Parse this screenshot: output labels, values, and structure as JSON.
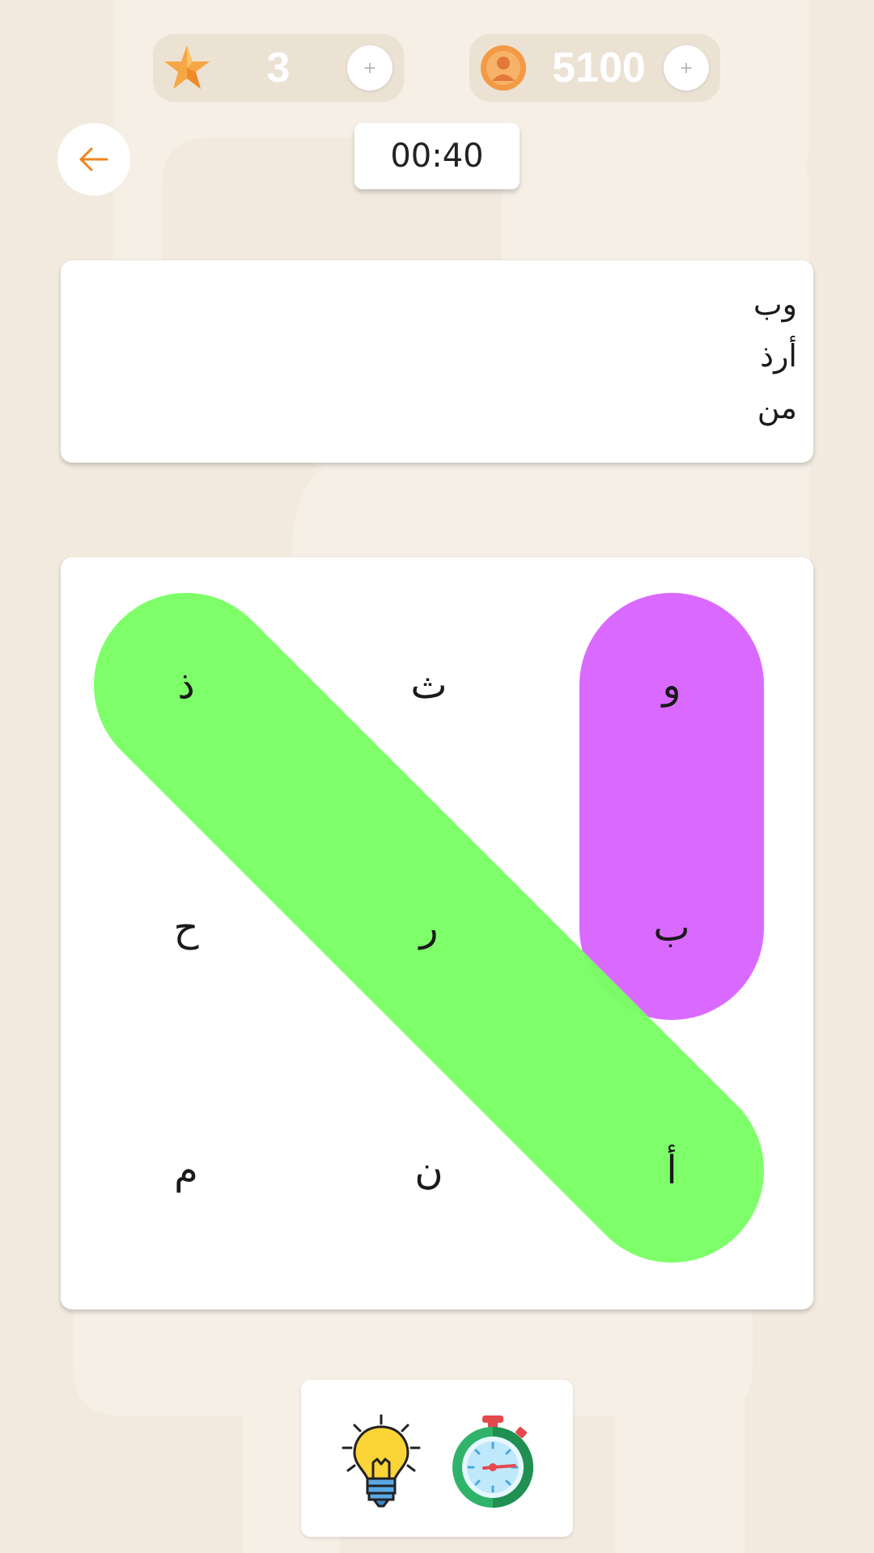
{
  "top_bar": {
    "stars": {
      "value": "3",
      "icon": "star-icon",
      "add_label": "+"
    },
    "coins": {
      "value": "5100",
      "icon": "coin-icon",
      "add_label": "+"
    }
  },
  "back_button": {
    "icon": "arrow-left-icon",
    "accent": "#f0841f"
  },
  "timer": {
    "value": "00:40"
  },
  "word_list": [
    "وب",
    "أرذ",
    "من"
  ],
  "grid": {
    "rows": 3,
    "cols": 3,
    "letters": [
      [
        "ذ",
        "ث",
        "و"
      ],
      [
        "ح",
        "ر",
        "ب"
      ],
      [
        "م",
        "ن",
        "أ"
      ]
    ]
  },
  "found_words": [
    {
      "word": "وب",
      "color": "#d966ff",
      "from": [
        0,
        2
      ],
      "to": [
        1,
        2
      ]
    },
    {
      "word": "أرذ",
      "color": "#7aff66",
      "from": [
        0,
        0
      ],
      "to": [
        2,
        2
      ]
    }
  ],
  "powerups": [
    {
      "name": "hint",
      "icon": "lightbulb-icon"
    },
    {
      "name": "extra-time",
      "icon": "stopwatch-icon"
    }
  ]
}
